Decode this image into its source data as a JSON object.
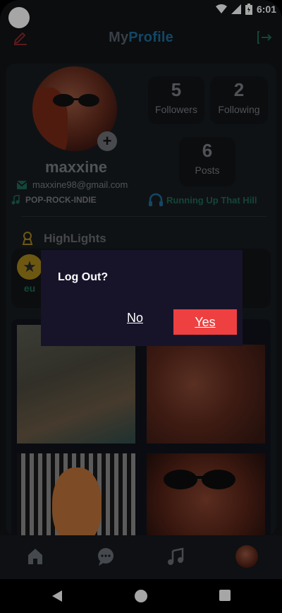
{
  "status_bar": {
    "time": "6:01"
  },
  "app_bar": {
    "title_part1": "My",
    "title_part2": "Profile"
  },
  "profile": {
    "username": "maxxine",
    "email": "maxxine98@gmail.com",
    "genres": "POP-ROCK-INDIE",
    "song": "Running Up That Hill",
    "add_photo_label": "+"
  },
  "stats": {
    "followers": {
      "count": "5",
      "label": "Followers"
    },
    "following": {
      "count": "2",
      "label": "Following"
    },
    "posts": {
      "count": "6",
      "label": "Posts"
    }
  },
  "highlights": {
    "title": "HighLights",
    "items": [
      {
        "label": "eu"
      }
    ]
  },
  "dialog": {
    "title": "Log Out?",
    "no_label": "No",
    "yes_label": "Yes"
  },
  "nav": {
    "items": [
      "home-icon",
      "chat-icon",
      "music-icon",
      "profile-avatar"
    ]
  },
  "colors": {
    "accent_blue": "#1e6e9b",
    "accent_green": "#1f6a55",
    "danger": "#ee4040",
    "dialog_bg": "#17142a"
  }
}
